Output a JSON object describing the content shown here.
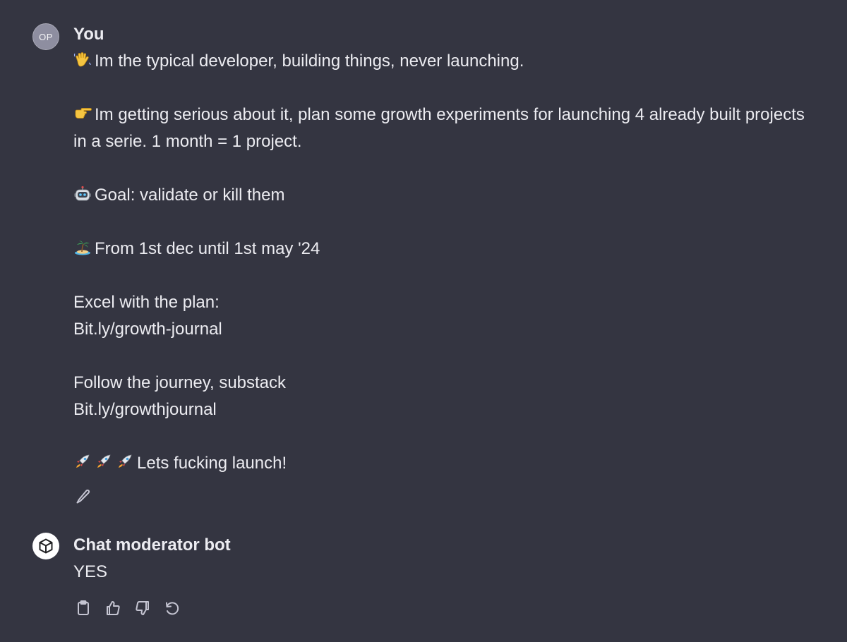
{
  "messages": {
    "user": {
      "avatar_initials": "OP",
      "author": "You",
      "line1": "Im the typical developer, building things, never launching.",
      "line2": "Im getting serious about it, plan some growth experiments for launching 4 already built projects in a serie. 1 month = 1 project.",
      "line3": "Goal: validate or kill them",
      "line4": "From 1st dec until 1st may '24",
      "line5": "Excel with the plan:",
      "line6": "Bit.ly/growth-journal",
      "line7": "Follow the journey, substack",
      "line8": "Bit.ly/growthjournal",
      "line9": "Lets fucking launch!",
      "emojis": [
        "waving-hand-icon",
        "pointing-hand-icon",
        "robot-icon",
        "island-icon",
        "rocket-icon"
      ]
    },
    "bot": {
      "author": "Chat moderator bot",
      "text": "YES"
    }
  },
  "actions": {
    "edit": "pencil-icon",
    "copy": "clipboard-icon",
    "like": "thumbs-up-icon",
    "dislike": "thumbs-down-icon",
    "regenerate": "regenerate-icon"
  }
}
